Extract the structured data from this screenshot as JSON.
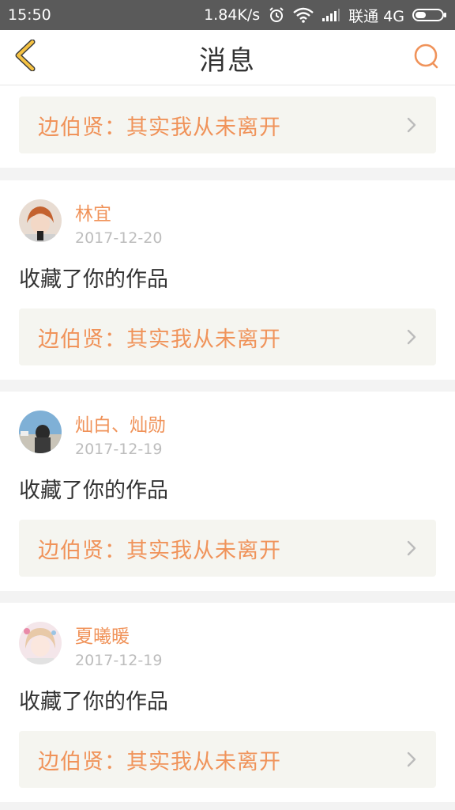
{
  "status_bar": {
    "time": "15:50",
    "speed": "1.84K/s",
    "carrier": "联通 4G"
  },
  "header": {
    "title": "消息"
  },
  "colors": {
    "accent": "#f0935a",
    "back_arrow": "#f5c242",
    "link_bg": "#f5f5f0",
    "date": "#bdbdbd"
  },
  "top_card": {
    "work_title": "边伯贤：其实我从未离开"
  },
  "messages": [
    {
      "user": "林宜",
      "date": "2017-12-20",
      "action": "收藏了你的作品",
      "work_title": "边伯贤：其实我从未离开"
    },
    {
      "user": "灿白、灿勋",
      "date": "2017-12-19",
      "action": "收藏了你的作品",
      "work_title": "边伯贤：其实我从未离开"
    },
    {
      "user": "夏曦暖",
      "date": "2017-12-19",
      "action": "收藏了你的作品",
      "work_title": "边伯贤：其实我从未离开"
    }
  ]
}
